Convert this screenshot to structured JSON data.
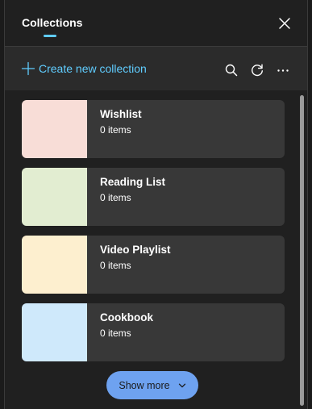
{
  "header": {
    "title": "Collections"
  },
  "toolbar": {
    "create_label": "Create new collection"
  },
  "collections": [
    {
      "name": "Wishlist",
      "count": "0 items",
      "color": "#f8ddd7"
    },
    {
      "name": "Reading List",
      "count": "0 items",
      "color": "#e2edd1"
    },
    {
      "name": "Video Playlist",
      "count": "0 items",
      "color": "#fdefcf"
    },
    {
      "name": "Cookbook",
      "count": "0 items",
      "color": "#cfe9fb"
    }
  ],
  "show_more": {
    "label": "Show more"
  },
  "colors": {
    "accent": "#60cdff",
    "button": "#6ea2f0"
  }
}
